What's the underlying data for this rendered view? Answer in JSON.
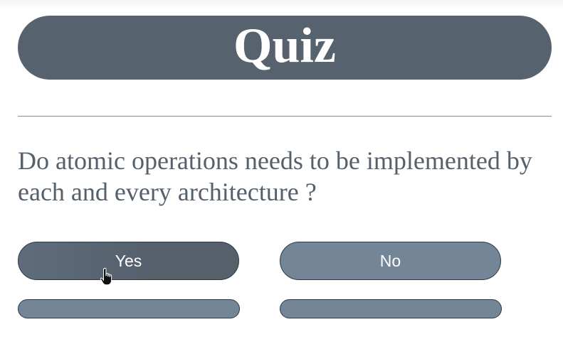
{
  "quiz": {
    "title": "Quiz",
    "question": "Do atomic operations needs to be implemented by each and every architecture ?",
    "answers": [
      {
        "label": "Yes"
      },
      {
        "label": "No"
      }
    ]
  },
  "colors": {
    "title_bar": "#56626d",
    "question_text": "#55606b",
    "yes_button": "#55606b",
    "no_button": "#738597",
    "divider": "#8a8a8a"
  },
  "icons": {
    "cursor": "hand-pointer-icon"
  }
}
